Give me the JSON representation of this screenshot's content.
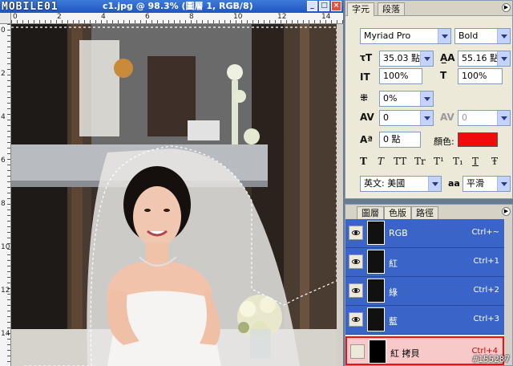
{
  "document": {
    "title": "c1.jpg @ 98.3% (圖層 1, RGB/8)",
    "watermark": "MOBILE01",
    "ruler_top_ticks": [
      "0",
      "2",
      "4",
      "6",
      "8",
      "10",
      "12",
      "14"
    ],
    "ruler_left_ticks": [
      "0",
      "2",
      "4",
      "6",
      "8",
      "10",
      "12",
      "14"
    ]
  },
  "character_panel": {
    "tabs": [
      {
        "label": "字元",
        "active": true
      },
      {
        "label": "段落",
        "active": false
      }
    ],
    "font_family": "Myriad Pro",
    "font_style": "Bold",
    "font_size": "35.03 點",
    "leading": "55.16 點",
    "vertical_scale": "100%",
    "horizontal_scale": "100%",
    "tsume": "0%",
    "kerning": "0",
    "tracking": "0",
    "baseline_shift": "0 點",
    "color_label": "顏色:",
    "text_color": "#f00c0c",
    "style_buttons": [
      "T",
      "T",
      "TT",
      "Tr",
      "T¹",
      "T₁",
      "T",
      "Ŧ"
    ],
    "language": "英文: 美國",
    "antialias_icon": "aa",
    "antialias": "平滑"
  },
  "channels_panel": {
    "tabs": [
      {
        "label": "圖層",
        "active": false
      },
      {
        "label": "色版",
        "active": true
      },
      {
        "label": "路徑",
        "active": false
      }
    ],
    "channels": [
      {
        "name": "RGB",
        "shortcut": "Ctrl+~",
        "visible": true
      },
      {
        "name": "紅",
        "shortcut": "Ctrl+1",
        "visible": true
      },
      {
        "name": "綠",
        "shortcut": "Ctrl+2",
        "visible": true
      },
      {
        "name": "藍",
        "shortcut": "Ctrl+3",
        "visible": true
      },
      {
        "name": "紅 拷貝",
        "shortcut": "Ctrl+4",
        "visible": false
      }
    ]
  },
  "reference_id": "#155287"
}
